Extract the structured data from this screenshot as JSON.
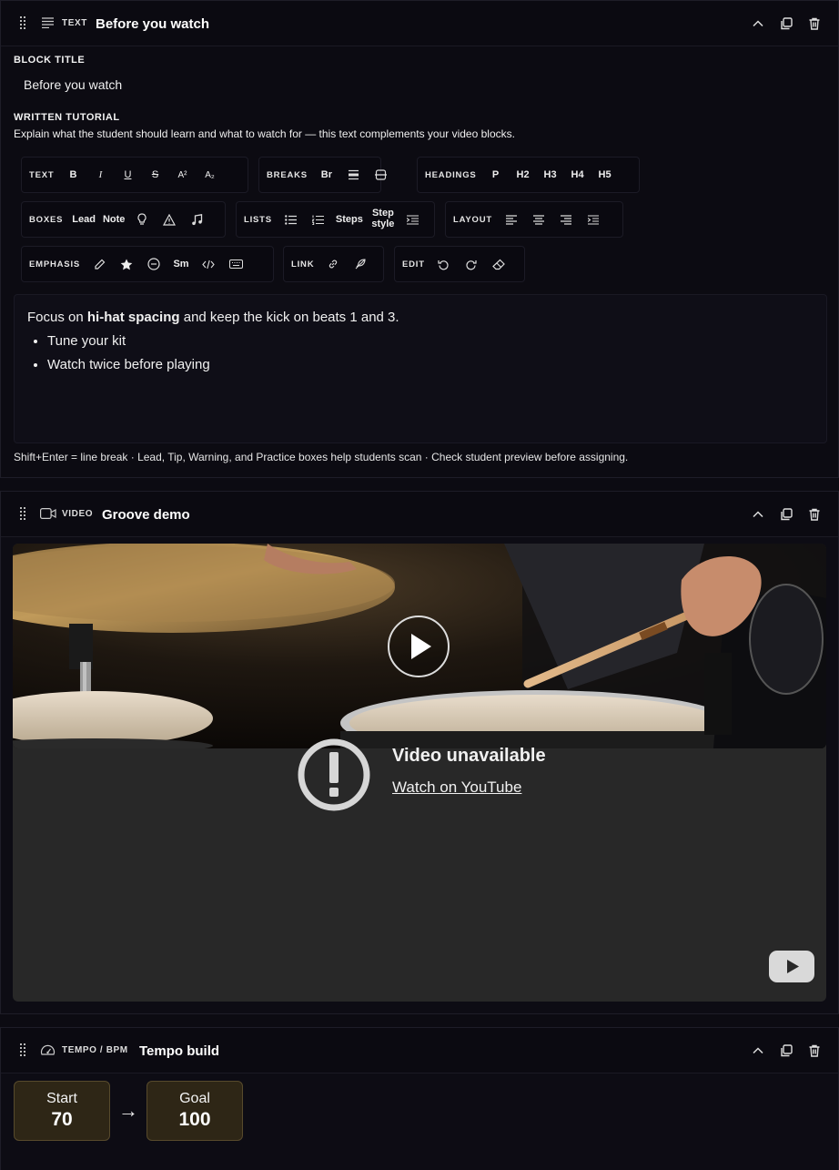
{
  "text_block": {
    "type": "TEXT",
    "title": "Before you watch",
    "block_title_label": "BLOCK TITLE",
    "block_title_value": "Before you watch",
    "tutorial_label": "WRITTEN TUTORIAL",
    "tutorial_help": "Explain what the student should learn and what to watch for — this text complements your video blocks.",
    "toolbar": {
      "text": {
        "label": "TEXT",
        "bold": "B",
        "italic": "I",
        "underline": "U",
        "strike": "S",
        "sup": "A²",
        "sub": "A₂"
      },
      "breaks": {
        "label": "BREAKS",
        "br": "Br"
      },
      "headings": {
        "label": "HEADINGS",
        "p": "P",
        "h2": "H2",
        "h3": "H3",
        "h4": "H4",
        "h5": "H5"
      },
      "boxes": {
        "label": "BOXES",
        "lead": "Lead",
        "note": "Note"
      },
      "lists": {
        "label": "LISTS",
        "steps": "Steps",
        "step_style": "Step style"
      },
      "layout": {
        "label": "LAYOUT"
      },
      "emphasis": {
        "label": "EMPHASIS",
        "sm": "Sm"
      },
      "link": {
        "label": "LINK"
      },
      "edit": {
        "label": "EDIT"
      }
    },
    "content": {
      "before": "Focus on ",
      "strong": "hi-hat spacing",
      "after": " and keep the kick on beats 1 and 3.",
      "bullets": [
        "Tune your kit",
        "Watch twice before playing"
      ]
    },
    "hint": "Shift+Enter = line break · Lead, Tip, Warning, and Practice boxes help students scan · Check student preview before assigning."
  },
  "video_block": {
    "type": "VIDEO",
    "title": "Groove demo",
    "unavailable": "Video unavailable",
    "watch_link": "Watch on YouTube"
  },
  "tempo_block": {
    "type": "TEMPO / BPM",
    "title": "Tempo build",
    "start_label": "Start",
    "start_value": "70",
    "arrow": "→",
    "goal_label": "Goal",
    "goal_value": "100"
  },
  "colors": {
    "accent_card": "#2e2616",
    "background": "#0c0b12"
  }
}
